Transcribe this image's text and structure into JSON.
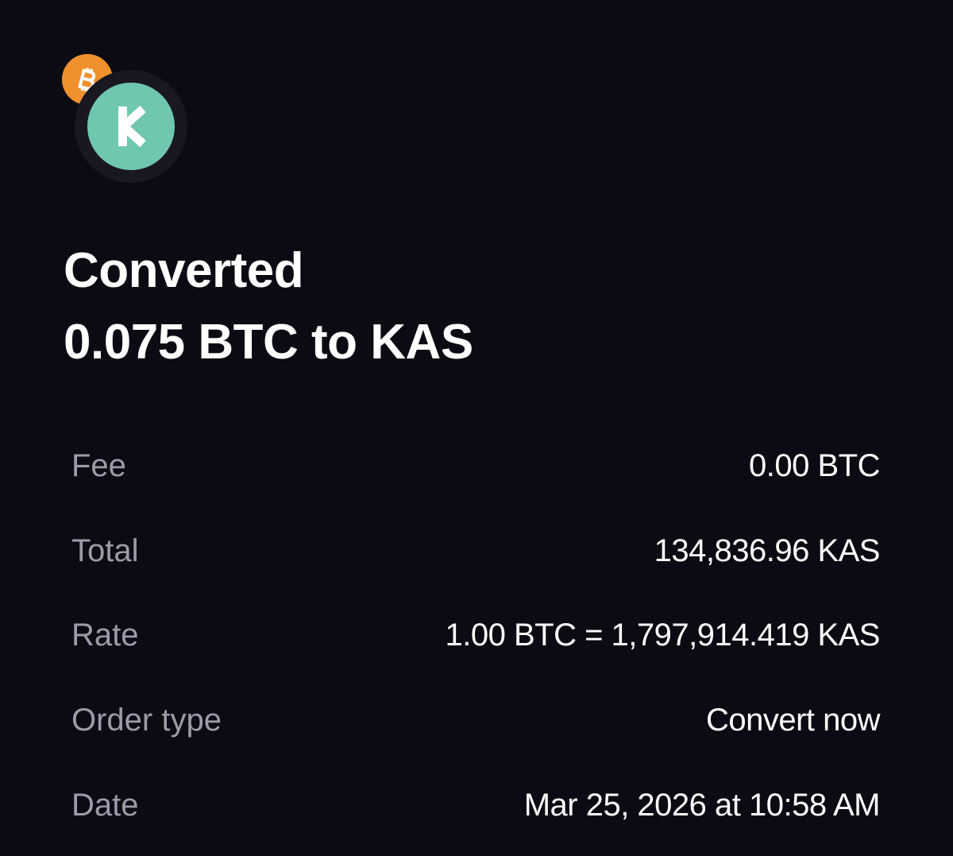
{
  "assets": {
    "from_icon": "bitcoin-icon",
    "to_icon": "kaspa-icon",
    "from_color": "#f0912e",
    "to_color": "#70c7b0"
  },
  "title": {
    "line1": "Converted",
    "line2": "0.075 BTC to KAS"
  },
  "details": [
    {
      "label": "Fee",
      "value": "0.00 BTC"
    },
    {
      "label": "Total",
      "value": "134,836.96 KAS"
    },
    {
      "label": "Rate",
      "value": "1.00 BTC = 1,797,914.419 KAS"
    },
    {
      "label": "Order type",
      "value": "Convert now"
    },
    {
      "label": "Date",
      "value": "Mar 25, 2026 at 10:58 AM"
    }
  ]
}
